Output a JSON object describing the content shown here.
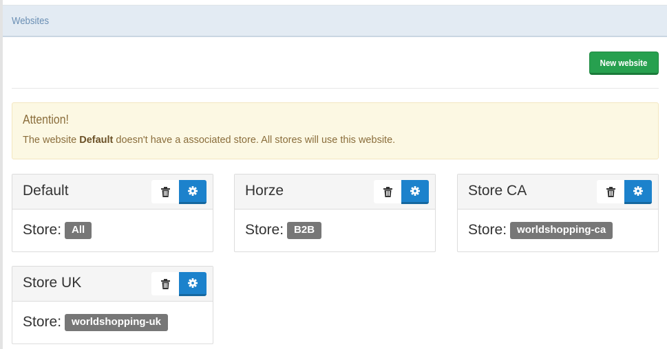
{
  "header": {
    "title": "Websites"
  },
  "toolbar": {
    "new_website_label": "New website"
  },
  "alert": {
    "title": "Attention!",
    "text_before": "The website ",
    "highlight": "Default",
    "text_after": " doesn't have a associated store. All stores will use this website."
  },
  "websites": [
    {
      "name": "Default",
      "store_label": "Store:",
      "store": "All"
    },
    {
      "name": "Horze",
      "store_label": "Store:",
      "store": "B2B"
    },
    {
      "name": "Store CA",
      "store_label": "Store:",
      "store": "worldshopping-ca"
    },
    {
      "name": "Store UK",
      "store_label": "Store:",
      "store": "worldshopping-uk"
    }
  ],
  "icons": {
    "delete": "trash-icon",
    "settings": "gear-icon"
  },
  "colors": {
    "header_bg": "#e3ebf3",
    "header_text": "#6a8fb4",
    "new_button": "#27a04f",
    "alert_bg": "#fcf8e3",
    "alert_text": "#8a6d3b",
    "settings_button": "#1c82cc",
    "badge_bg": "#777777"
  }
}
